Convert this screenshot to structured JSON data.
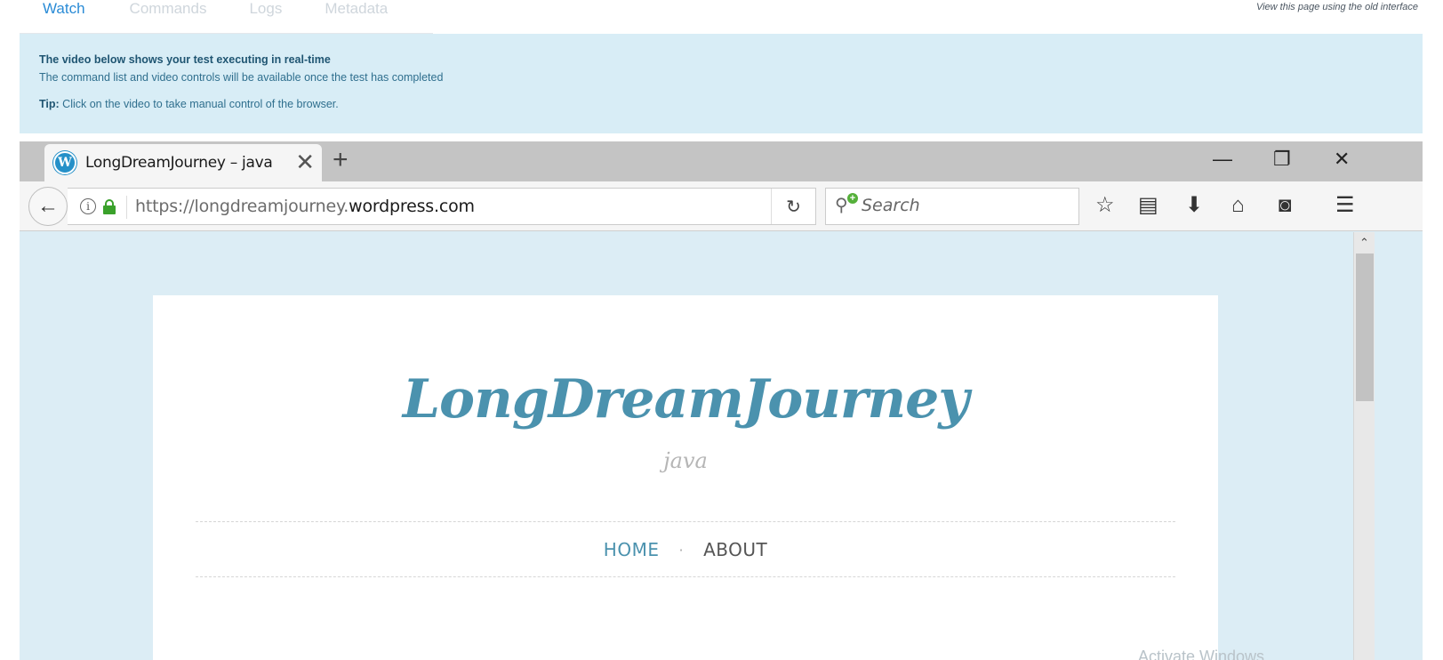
{
  "top_tabs": [
    {
      "label": "Watch",
      "active": true
    },
    {
      "label": "Commands",
      "active": false
    },
    {
      "label": "Logs",
      "active": false
    },
    {
      "label": "Metadata",
      "active": false
    }
  ],
  "old_interface_link": "View this page using the old interface",
  "banner": {
    "heading": "The video below shows your test executing in real-time",
    "subtext": "The command list and video controls will be available once the test has completed",
    "tip_label": "Tip:",
    "tip_text": " Click on the video to take manual control of the browser."
  },
  "browser": {
    "tab_title": "LongDreamJourney – java",
    "url_prefix": "https://longdreamjourney.",
    "url_domain": "wordpress.com",
    "search_placeholder": "Search",
    "icons": {
      "back": "←",
      "close_tab": "✕",
      "new_tab": "+",
      "minimize": "—",
      "restore": "❐",
      "close_window": "✕",
      "reload": "↻",
      "bookmark": "☆",
      "reader": "▤",
      "download": "⬇",
      "home": "⌂",
      "pocket": "◙",
      "menu": "☰",
      "scroll_up": "⌃"
    }
  },
  "site": {
    "title": "LongDreamJourney",
    "tagline": "java",
    "nav": {
      "home": "HOME",
      "separator": "·",
      "about": "ABOUT"
    }
  },
  "watermark": "Activate Windows",
  "colors": {
    "accent": "#2a8bd6",
    "banner_bg": "#d8edf6",
    "site_title": "#4b92ae",
    "lock_green": "#3aa12b"
  }
}
